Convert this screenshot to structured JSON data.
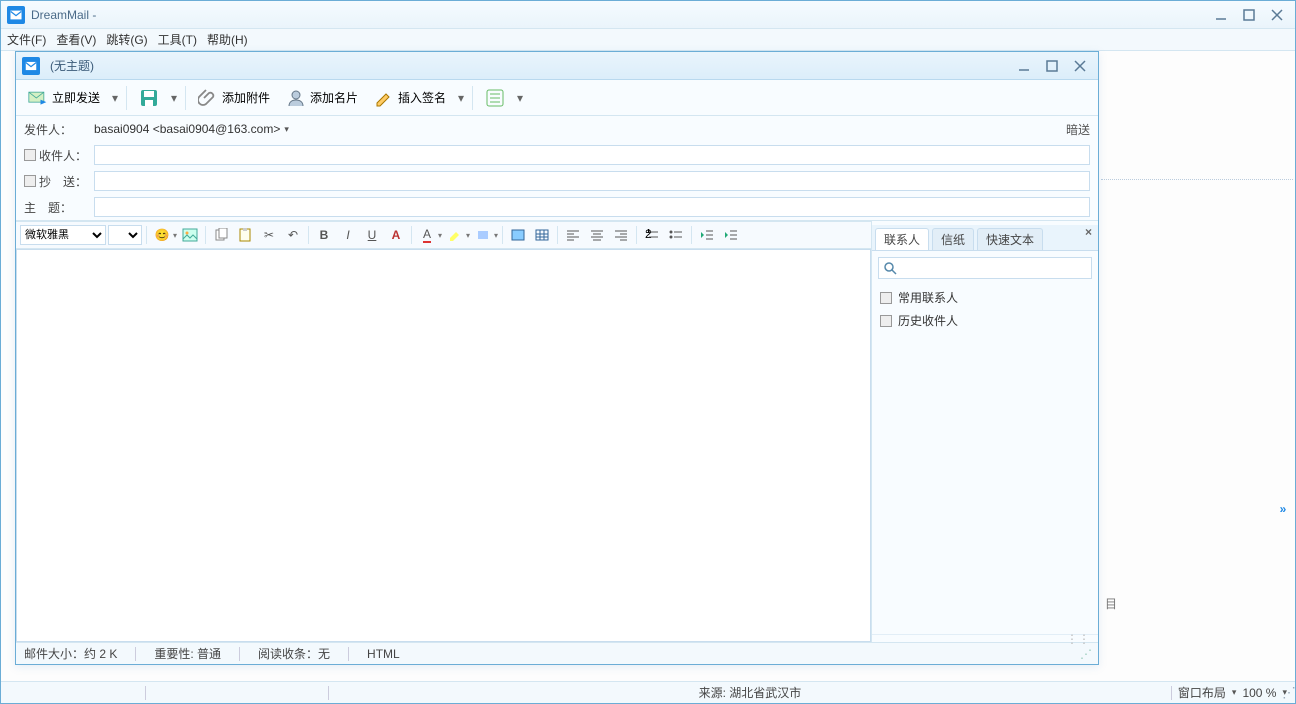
{
  "app": {
    "title": "DreamMail -"
  },
  "menus": {
    "file": "文件(F)",
    "view": "查看(V)",
    "go": "跳转(G)",
    "tools": "工具(T)",
    "help": "帮助(H)"
  },
  "compose": {
    "title": "(无主题)",
    "toolbar": {
      "send": "立即发送",
      "attach": "添加附件",
      "vcard": "添加名片",
      "signature": "插入签名"
    },
    "fields": {
      "from_label": "发件人：",
      "from_value": "basai0904 <basai0904@163.com>",
      "bcc": "暗送",
      "to_label": "收件人：",
      "cc_label": "抄　送：",
      "subject_label": "主　题："
    },
    "editor": {
      "font": "微软雅黑",
      "size": ""
    },
    "side": {
      "tabs": {
        "contacts": "联系人",
        "stationery": "信纸",
        "quick": "快速文本"
      },
      "items": {
        "frequent": "常用联系人",
        "history": "历史收件人"
      }
    },
    "status": {
      "size": "邮件大小：约 2 K",
      "priority": "重要性: 普通",
      "receipt": "阅读收条：无",
      "mode": "HTML"
    }
  },
  "status": {
    "source": "来源: 湖北省武汉市",
    "layout": "窗口布局",
    "zoom": "100 %"
  }
}
